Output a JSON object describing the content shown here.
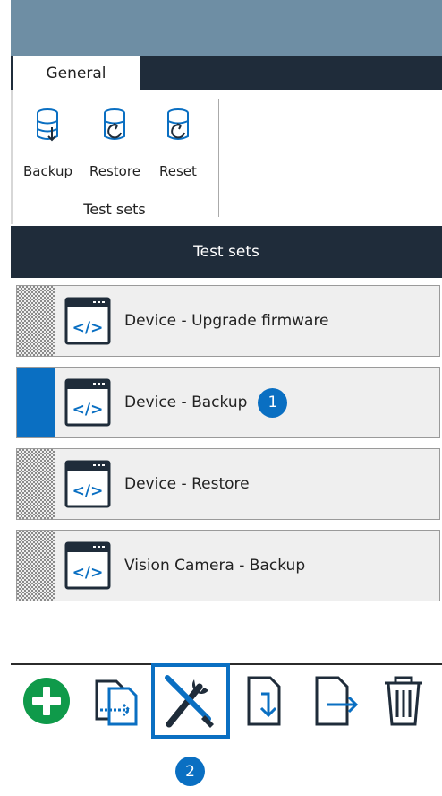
{
  "ribbon": {
    "tab_general": "General",
    "backup_label": "Backup",
    "restore_label": "Restore",
    "reset_label": "Reset",
    "group_label": "Test sets"
  },
  "panel": {
    "title": "Test sets",
    "items": [
      {
        "name": "Device - Upgrade firmware",
        "selected": false
      },
      {
        "name": "Device - Backup",
        "selected": true
      },
      {
        "name": "Device - Restore",
        "selected": false
      },
      {
        "name": "Vision Camera - Backup",
        "selected": false
      }
    ]
  },
  "callouts": {
    "one": "1",
    "two": "2"
  },
  "toolbar": {
    "icons": [
      "add-icon",
      "copy-icon",
      "tools-icon",
      "import-icon",
      "export-icon",
      "trash-icon"
    ]
  },
  "colors": {
    "accent": "#0a6fc2",
    "dark": "#1f2c3a",
    "topbar": "#6e8ea4",
    "add_green": "#0f9a4a"
  }
}
